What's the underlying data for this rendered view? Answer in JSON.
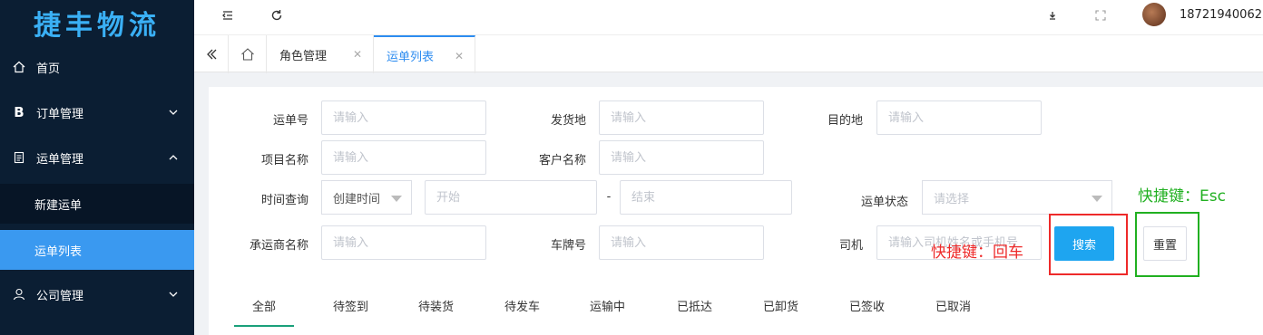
{
  "logo": "捷丰物流",
  "sidebar": {
    "items": [
      {
        "label": "首页"
      },
      {
        "label": "订单管理"
      },
      {
        "label": "运单管理"
      },
      {
        "label": "新建运单"
      },
      {
        "label": "运单列表"
      },
      {
        "label": "公司管理"
      }
    ]
  },
  "header": {
    "username": "18721940062"
  },
  "tabs": [
    {
      "label": "角色管理"
    },
    {
      "label": "运单列表"
    }
  ],
  "form": {
    "waybill_no": {
      "label": "运单号",
      "placeholder": "请输入"
    },
    "origin": {
      "label": "发货地",
      "placeholder": "请输入"
    },
    "destination": {
      "label": "目的地",
      "placeholder": "请输入"
    },
    "project": {
      "label": "项目名称",
      "placeholder": "请输入"
    },
    "customer": {
      "label": "客户名称",
      "placeholder": "请输入"
    },
    "time_query": {
      "label": "时间查询",
      "select_value": "创建时间",
      "start_placeholder": "开始",
      "separator": "-",
      "end_placeholder": "结束"
    },
    "status": {
      "label": "运单状态",
      "placeholder": "请选择"
    },
    "carrier": {
      "label": "承运商名称",
      "placeholder": "请输入"
    },
    "plate": {
      "label": "车牌号",
      "placeholder": "请输入"
    },
    "driver": {
      "label": "司机",
      "placeholder": "请输入司机姓名或手机号"
    }
  },
  "buttons": {
    "search": "搜索",
    "reset": "重置"
  },
  "annotations": {
    "enter": "快捷键：回车",
    "esc": "快捷键：Esc"
  },
  "status_tabs": [
    "全部",
    "待签到",
    "待装货",
    "待发车",
    "运输中",
    "已抵达",
    "已卸货",
    "已签收",
    "已取消"
  ],
  "colors": {
    "sidebar_bg": "#0b1e33",
    "active_nav": "#3a99f0",
    "accent": "#2d8cf0",
    "search_button": "#1ea5f0",
    "annotation_red": "#ee2a2a",
    "annotation_green": "#21b021"
  }
}
